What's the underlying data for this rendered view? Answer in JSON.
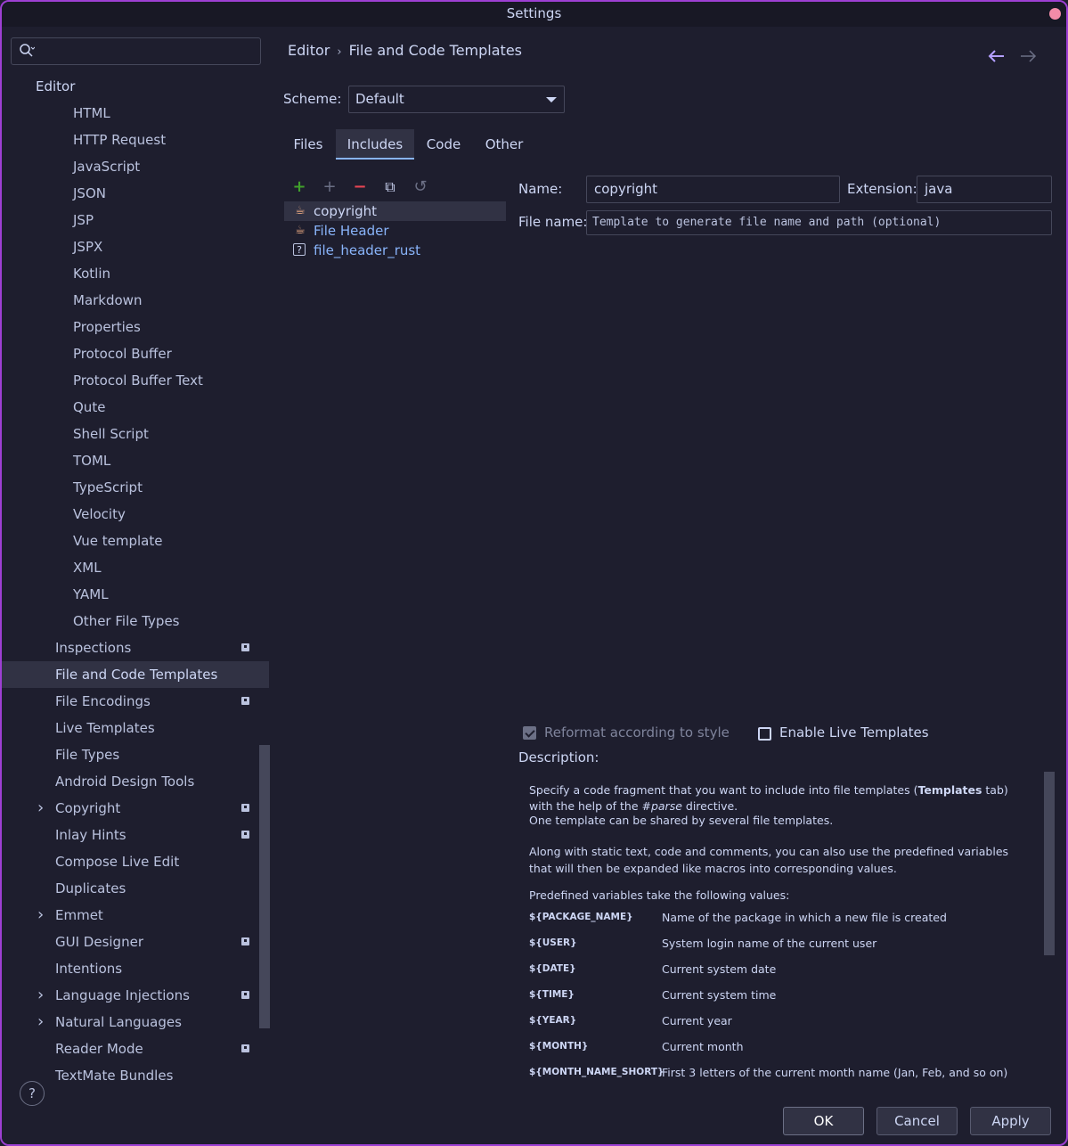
{
  "window": {
    "title": "Settings"
  },
  "sidebar": {
    "search_placeholder": "",
    "root": "Editor",
    "items": [
      {
        "label": "HTML",
        "indent": 2
      },
      {
        "label": "HTTP Request",
        "indent": 2
      },
      {
        "label": "JavaScript",
        "indent": 2
      },
      {
        "label": "JSON",
        "indent": 2
      },
      {
        "label": "JSP",
        "indent": 2
      },
      {
        "label": "JSPX",
        "indent": 2
      },
      {
        "label": "Kotlin",
        "indent": 2
      },
      {
        "label": "Markdown",
        "indent": 2
      },
      {
        "label": "Properties",
        "indent": 2
      },
      {
        "label": "Protocol Buffer",
        "indent": 2
      },
      {
        "label": "Protocol Buffer Text",
        "indent": 2
      },
      {
        "label": "Qute",
        "indent": 2
      },
      {
        "label": "Shell Script",
        "indent": 2
      },
      {
        "label": "TOML",
        "indent": 2
      },
      {
        "label": "TypeScript",
        "indent": 2
      },
      {
        "label": "Velocity",
        "indent": 2
      },
      {
        "label": "Vue template",
        "indent": 2
      },
      {
        "label": "XML",
        "indent": 2
      },
      {
        "label": "YAML",
        "indent": 2
      },
      {
        "label": "Other File Types",
        "indent": 2
      },
      {
        "label": "Inspections",
        "indent": 1,
        "badge": true
      },
      {
        "label": "File and Code Templates",
        "indent": 1,
        "selected": true
      },
      {
        "label": "File Encodings",
        "indent": 1,
        "badge": true
      },
      {
        "label": "Live Templates",
        "indent": 1
      },
      {
        "label": "File Types",
        "indent": 1
      },
      {
        "label": "Android Design Tools",
        "indent": 1
      },
      {
        "label": "Copyright",
        "indent": 1,
        "expandable": true,
        "badge": true
      },
      {
        "label": "Inlay Hints",
        "indent": 1,
        "badge": true
      },
      {
        "label": "Compose Live Edit",
        "indent": 1
      },
      {
        "label": "Duplicates",
        "indent": 1
      },
      {
        "label": "Emmet",
        "indent": 1,
        "expandable": true
      },
      {
        "label": "GUI Designer",
        "indent": 1,
        "badge": true
      },
      {
        "label": "Intentions",
        "indent": 1
      },
      {
        "label": "Language Injections",
        "indent": 1,
        "expandable": true,
        "badge": true
      },
      {
        "label": "Natural Languages",
        "indent": 1,
        "expandable": true
      },
      {
        "label": "Reader Mode",
        "indent": 1,
        "badge": true
      },
      {
        "label": "TextMate Bundles",
        "indent": 1
      }
    ],
    "help_label": "?"
  },
  "breadcrumb": {
    "parent": "Editor",
    "sep": "›",
    "current": "File and Code Templates"
  },
  "scheme": {
    "label": "Scheme:",
    "value": "Default"
  },
  "tabs": [
    {
      "label": "Files",
      "active": false
    },
    {
      "label": "Includes",
      "active": true
    },
    {
      "label": "Code",
      "active": false
    },
    {
      "label": "Other",
      "active": false
    }
  ],
  "toolbar": {
    "add": "+",
    "add_child": "+",
    "remove": "−",
    "copy": "⧉",
    "reset": "↺"
  },
  "colors": {
    "add": "#40a02b",
    "remove": "#e64553",
    "disabled": "#6c7086",
    "accent": "#89b4fa",
    "link": "#89b4fa",
    "selected": "#313244"
  },
  "templates": [
    {
      "label": "copyright",
      "icon": "cup-icon",
      "selected": true,
      "color": "#cdd6f4"
    },
    {
      "label": "File Header",
      "icon": "cup-icon",
      "selected": false,
      "color": "#89b4fa"
    },
    {
      "label": "file_header_rust",
      "icon": "unknown-file-icon",
      "selected": false,
      "color": "#89b4fa"
    }
  ],
  "form": {
    "name_label": "Name:",
    "name_value": "copyright",
    "ext_label": "Extension:",
    "ext_value": "java",
    "filename_label": "File name:",
    "filename_placeholder": "Template to generate file name and path (optional)",
    "reformat_label": "Reformat according to style",
    "reformat_checked": true,
    "live_label": "Enable Live Templates",
    "live_checked": false,
    "description_label": "Description:"
  },
  "description": {
    "p1_a": "Specify a code fragment that you want to include into file templates (",
    "p1_b": "Templates",
    "p1_c": " tab) with the help of the ",
    "p1_d": "#parse",
    "p1_e": " directive.",
    "p2": "One template can be shared by several file templates.",
    "p3": "Along with static text, code and comments, you can also use the predefined variables that will then be expanded like macros into corresponding values.",
    "p4": "Predefined variables take the following values:",
    "vars": [
      {
        "name": "${PACKAGE_NAME}",
        "desc": "Name of the package in which a new file is created"
      },
      {
        "name": "${USER}",
        "desc": "System login name of the current user"
      },
      {
        "name": "${DATE}",
        "desc": "Current system date"
      },
      {
        "name": "${TIME}",
        "desc": "Current system time"
      },
      {
        "name": "${YEAR}",
        "desc": "Current year"
      },
      {
        "name": "${MONTH}",
        "desc": "Current month"
      },
      {
        "name": "${MONTH_NAME_SHORT}",
        "desc": "First 3 letters of the current month name (Jan, Feb, and so on)"
      }
    ]
  },
  "buttons": {
    "ok": "OK",
    "cancel": "Cancel",
    "apply": "Apply"
  }
}
